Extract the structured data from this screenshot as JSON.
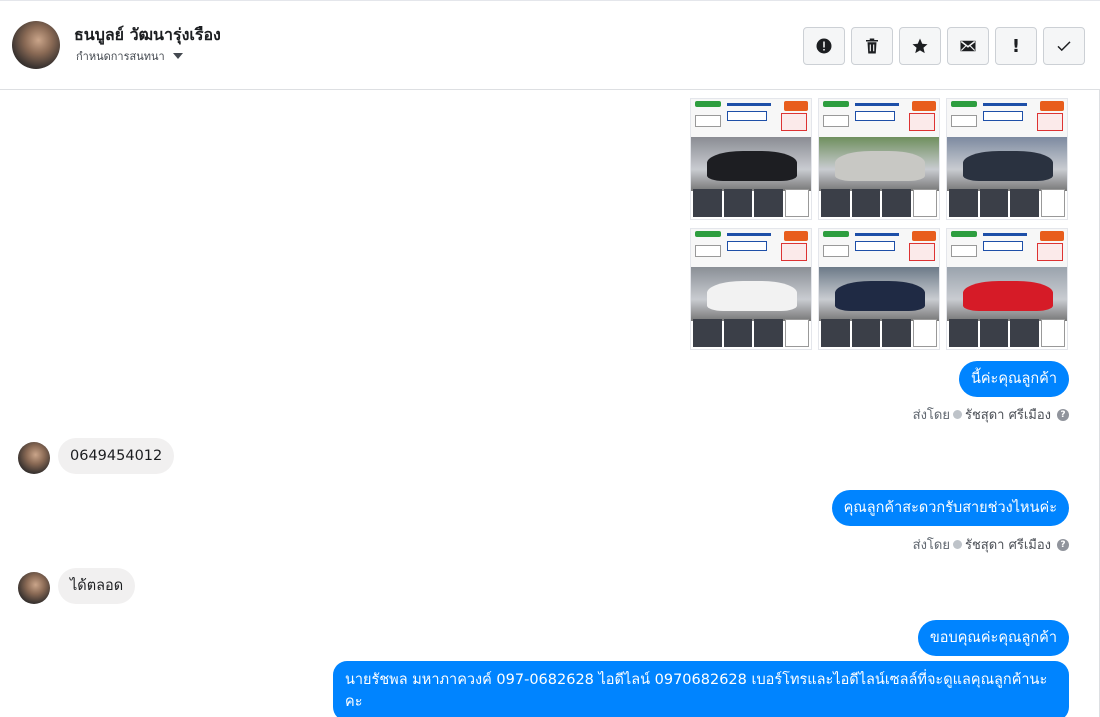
{
  "header": {
    "contact_name": "ธนบูลย์ วัฒนารุ่งเรือง",
    "assign_label": "กำหนดการสนทนา",
    "toolbar": [
      {
        "name": "spam-button",
        "icon": "alert-circle-icon"
      },
      {
        "name": "delete-button",
        "icon": "trash-icon"
      },
      {
        "name": "star-button",
        "icon": "star-icon"
      },
      {
        "name": "mark-unread-button",
        "icon": "envelope-icon"
      },
      {
        "name": "follow-up-button",
        "icon": "exclamation-icon"
      },
      {
        "name": "done-button",
        "icon": "checkmark-icon"
      }
    ]
  },
  "conversation": {
    "photos": [
      {
        "car_color": "#1d1e22"
      },
      {
        "car_color": "#c8c8c4"
      },
      {
        "car_color": "#2a3240"
      },
      {
        "car_color": "#f2f2f2"
      },
      {
        "car_color": "#1f2a44"
      },
      {
        "car_color": "#d61b27"
      }
    ],
    "messages": [
      {
        "text": "นี้ค่ะคุณลูกค้า"
      },
      {
        "text": "0649454012"
      },
      {
        "text": "คุณลูกค้าสะดวกรับสายช่วงไหนค่ะ"
      },
      {
        "text": "ได้ตลอด"
      },
      {
        "text": "ขอบคุณค่ะคุณลูกค้า"
      },
      {
        "text": "นายรัชพล มหาภาควงค์  097-0682628 ไอดีไลน์ 0970682628   เบอร์โทรและไอดีไลน์เซลล์ที่จะดูแลคุณลูกค้านะคะ"
      }
    ],
    "sent_by_label": "ส่งโดย",
    "agent_name": "รัชสุดา ศรีเมือง",
    "help_glyph": "?"
  },
  "colors": {
    "accent": "#0084ff",
    "incoming_bubble": "#f1f0f0"
  }
}
